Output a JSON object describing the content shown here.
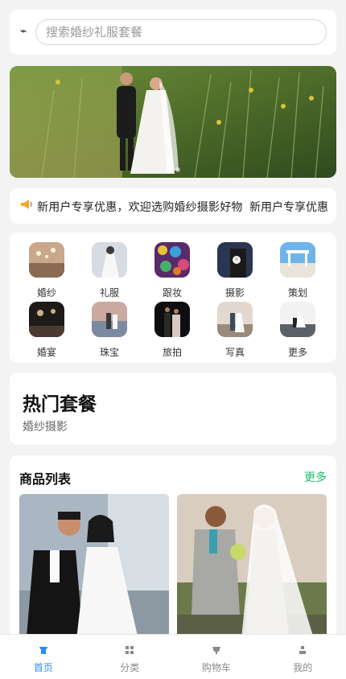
{
  "search": {
    "logo_glyph": "⌁",
    "placeholder": "搜索婚纱礼服套餐"
  },
  "banner": {
    "dot_count": 2,
    "active_dot": 0
  },
  "notice": {
    "text": "新用户专享优惠，欢迎选购婚纱摄影好物！",
    "right_text": "新用户专享优惠"
  },
  "categories": [
    {
      "label": "婚纱",
      "icon": "wedding-dress-icon"
    },
    {
      "label": "礼服",
      "icon": "gown-icon"
    },
    {
      "label": "跟妆",
      "icon": "makeup-icon"
    },
    {
      "label": "摄影",
      "icon": "photography-icon"
    },
    {
      "label": "策划",
      "icon": "planning-icon"
    },
    {
      "label": "婚宴",
      "icon": "banquet-icon"
    },
    {
      "label": "珠宝",
      "icon": "jewelry-icon"
    },
    {
      "label": "旅拍",
      "icon": "travel-photo-icon"
    },
    {
      "label": "写真",
      "icon": "portrait-icon"
    },
    {
      "label": "更多",
      "icon": "more-icon"
    }
  ],
  "hot": {
    "title": "热门套餐",
    "subtitle": "婚纱摄影"
  },
  "products": {
    "title": "商品列表",
    "more": "更多"
  },
  "tabbar": [
    {
      "label": "首页",
      "icon": "home-icon",
      "active": true
    },
    {
      "label": "分类",
      "icon": "grid-icon",
      "active": false
    },
    {
      "label": "购物车",
      "icon": "cart-icon",
      "active": false
    },
    {
      "label": "我的",
      "icon": "user-icon",
      "active": false
    }
  ],
  "colors": {
    "accent": "#2d8cf0",
    "more_green": "#19be6b",
    "page_bg": "#f3f3f3"
  }
}
